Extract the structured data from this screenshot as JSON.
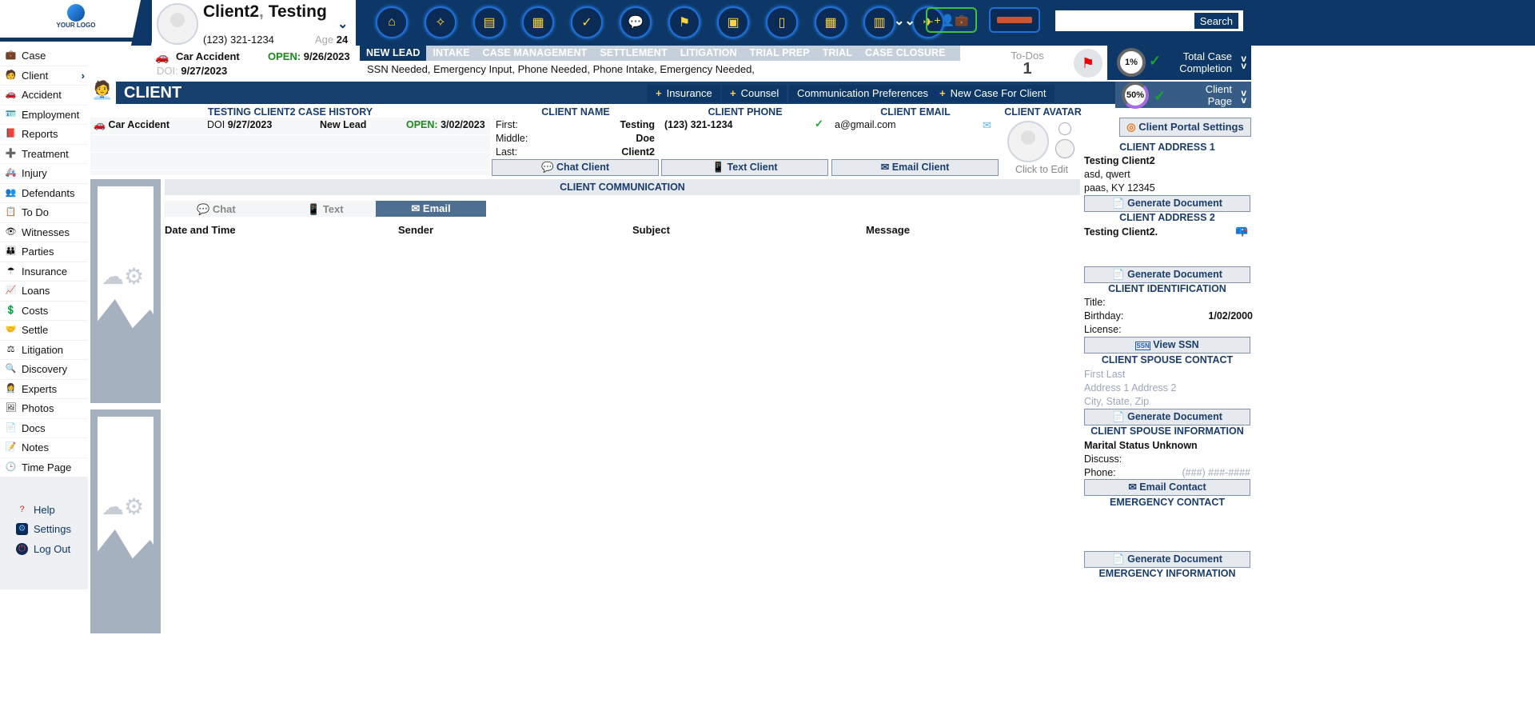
{
  "logo": {
    "text": "YOUR LOGO"
  },
  "client_card": {
    "last": "Client2",
    "first": "Testing",
    "phone": "(123) 321-1234",
    "age_label": "Age",
    "age": "24",
    "case_type": "Car Accident",
    "open_label": "OPEN:",
    "open_date": "9/26/2023",
    "doi_label": "DOI:",
    "doi": "9/27/2023"
  },
  "nav_icons": [
    "home-icon",
    "compass-icon",
    "document-icon",
    "calendar-icon",
    "check-icon",
    "chat-icon",
    "flag-icon",
    "chart-icon",
    "book-icon",
    "calculator-icon",
    "library-icon",
    "plane-icon"
  ],
  "search": {
    "placeholder": "",
    "button": "Search"
  },
  "stages": [
    "NEW LEAD",
    "INTAKE",
    "CASE MANAGEMENT",
    "SETTLEMENT",
    "LITIGATION",
    "TRIAL PREP",
    "TRIAL",
    "CASE CLOSURE"
  ],
  "active_stage": "NEW LEAD",
  "lead_note": "SSN Needed, Emergency Input, Phone Needed, Phone Intake, Emergency Needed,",
  "todos": {
    "label": "To-Dos",
    "count": "1"
  },
  "total_completion": {
    "percent": "1%",
    "label_1": "Total Case",
    "label_2": "Completion"
  },
  "page_completion": {
    "percent": "50%",
    "label_1": "Client",
    "label_2": "Page"
  },
  "sidebar": {
    "items": [
      "Case",
      "Client",
      "Accident",
      "Employment",
      "Reports",
      "Treatment",
      "Injury",
      "Defendants",
      "To Do",
      "Witnesses",
      "Parties",
      "Insurance",
      "Loans",
      "Costs",
      "Settle",
      "Litigation",
      "Discovery",
      "Experts",
      "Photos",
      "Docs",
      "Notes",
      "Time Page"
    ],
    "active": "Client",
    "bottom": [
      "Help",
      "Settings",
      "Log Out"
    ]
  },
  "client_bar": {
    "title": "CLIENT",
    "buttons": [
      "Insurance",
      "Counsel",
      "Communication Preferences",
      "New Case For Client"
    ]
  },
  "case_history": {
    "title": "TESTING CLIENT2 CASE HISTORY",
    "rows": [
      {
        "type": "Car Accident",
        "doi_label": "DOI",
        "doi": "9/27/2023",
        "stage": "New Lead",
        "open_label": "OPEN:",
        "open": "3/02/2023"
      }
    ]
  },
  "client_name": {
    "title": "CLIENT NAME",
    "first_label": "First:",
    "first": "Testing",
    "middle_label": "Middle:",
    "middle": "Doe",
    "last_label": "Last:",
    "last": "Client2"
  },
  "client_phone": {
    "title": "CLIENT PHONE",
    "value": "(123) 321-1234"
  },
  "client_email": {
    "title": "CLIENT EMAIL",
    "value": "a@gmail.com"
  },
  "client_avatar": {
    "title": "CLIENT AVATAR",
    "hint": "Click to Edit"
  },
  "actions": {
    "chat": "Chat Client",
    "text": "Text Client",
    "email": "Email Client"
  },
  "communication": {
    "title": "CLIENT COMMUNICATION",
    "tabs": [
      "Chat",
      "Text",
      "Email"
    ],
    "active_tab": "Email",
    "columns": [
      "Date and Time",
      "Sender",
      "Subject",
      "Message"
    ]
  },
  "right_panel": {
    "portal_settings": "Client Portal Settings",
    "address1": {
      "title": "CLIENT ADDRESS 1",
      "name": "Testing Client2",
      "line1": "asd, qwert",
      "line2": "paas, KY  12345"
    },
    "generate": "Generate Document",
    "address2": {
      "title": "CLIENT ADDRESS 2",
      "name": "Testing Client2."
    },
    "identification": {
      "title": "CLIENT IDENTIFICATION",
      "title_label": "Title:",
      "birthday_label": "Birthday:",
      "birthday": "1/02/2000",
      "license_label": "License:",
      "view_ssn": "View SSN"
    },
    "spouse_contact": {
      "title": "CLIENT SPOUSE CONTACT",
      "name": "First Last",
      "address": "Address 1 Address 2",
      "city": "City, State, Zip"
    },
    "spouse_info": {
      "title": "CLIENT SPOUSE INFORMATION",
      "marital": "Marital Status Unknown",
      "discuss_label": "Discuss:",
      "phone_label": "Phone:",
      "phone": "(###) ###-####",
      "email_contact": "Email Contact"
    },
    "emergency_contact": {
      "title": "EMERGENCY CONTACT"
    },
    "emergency_info": {
      "title": "EMERGENCY INFORMATION"
    }
  },
  "colors": {
    "navy": "#0d3766",
    "open_green": "#1a8a1a",
    "accent_yellow": "#ffd43b"
  }
}
